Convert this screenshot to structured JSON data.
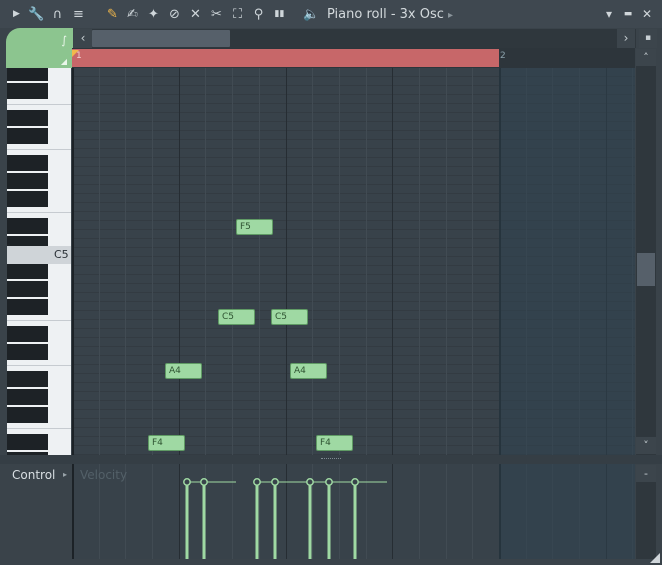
{
  "toolbar": {
    "arrow_icon": "play-arrow-icon",
    "tools": [
      {
        "name": "wrench-icon",
        "glyph": "🔧"
      },
      {
        "name": "magnet-icon",
        "glyph": "∩"
      },
      {
        "name": "menu-circle-icon",
        "glyph": "≡"
      },
      {
        "name": "pencil-icon",
        "glyph": "✎"
      },
      {
        "name": "brush-icon",
        "glyph": "✍"
      },
      {
        "name": "magic-icon",
        "glyph": "✦"
      },
      {
        "name": "delete-icon",
        "glyph": "⊘"
      },
      {
        "name": "mute-icon",
        "glyph": "✕"
      },
      {
        "name": "slice-icon",
        "glyph": "✂"
      },
      {
        "name": "select-icon",
        "glyph": "⛶"
      },
      {
        "name": "zoom-icon",
        "glyph": "⚲"
      },
      {
        "name": "playback-icon",
        "glyph": "▮▮"
      }
    ],
    "speaker_glyph": "🔈",
    "title": "Piano roll - 3x Osc",
    "title_arrow": "▸",
    "win_controls": [
      "▾",
      "▬",
      "✕"
    ]
  },
  "scroll": {
    "left": "‹",
    "right": "›",
    "up": "˄",
    "down": "˅",
    "menu": "▪"
  },
  "timeline": {
    "bar1": "1",
    "bar2": "2"
  },
  "keyboard": {
    "c5_label": "C5",
    "c5_row": 13,
    "row_height": 9,
    "visible_rows": 43
  },
  "notes": [
    {
      "label": "F5",
      "start": 1.5,
      "length": 0.35,
      "row": 10
    },
    {
      "label": "C5",
      "start": 1.33,
      "length": 0.35,
      "row": 20
    },
    {
      "label": "C5",
      "start": 1.83,
      "length": 0.35,
      "row": 20
    },
    {
      "label": "A4",
      "start": 0.83,
      "length": 0.35,
      "row": 26
    },
    {
      "label": "A4",
      "start": 2.0,
      "length": 0.35,
      "row": 26
    },
    {
      "label": "F4",
      "start": 0.67,
      "length": 0.35,
      "row": 34
    },
    {
      "label": "F4",
      "start": 2.25,
      "length": 0.35,
      "row": 34
    }
  ],
  "control": {
    "label": "Control",
    "arrow": "▸",
    "parameter": "Velocity"
  },
  "velocities": [
    {
      "start": 0.67,
      "level": 0.85
    },
    {
      "start": 0.83,
      "level": 0.85
    },
    {
      "start": 1.33,
      "level": 0.85
    },
    {
      "start": 1.5,
      "level": 0.85
    },
    {
      "start": 1.83,
      "level": 0.85
    },
    {
      "start": 2.0,
      "level": 0.85
    },
    {
      "start": 2.25,
      "level": 0.85
    }
  ],
  "colors": {
    "note_fill": "#9fd9a3",
    "loop_region": "#c76769",
    "accent_green": "#8cc58f"
  }
}
